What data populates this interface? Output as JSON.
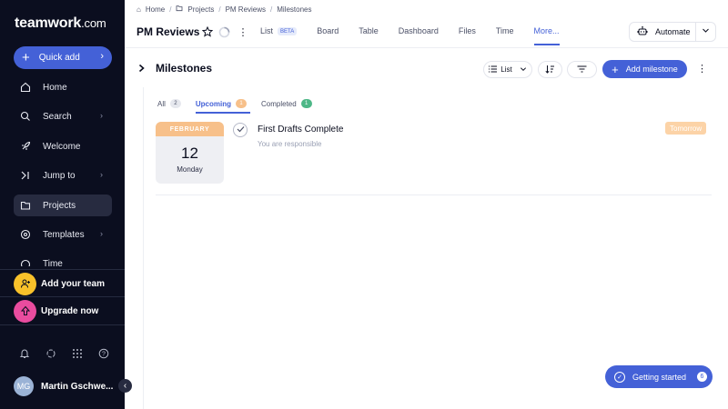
{
  "sidebar": {
    "logo_main": "teamwork",
    "logo_suffix": ".com",
    "quick_add": "Quick add",
    "items": [
      {
        "label": "Home"
      },
      {
        "label": "Search"
      },
      {
        "label": "Welcome"
      },
      {
        "label": "Jump to"
      },
      {
        "label": "Projects"
      },
      {
        "label": "Templates"
      },
      {
        "label": "Time"
      }
    ],
    "add_team": "Add your team",
    "upgrade": "Upgrade now",
    "user_initials": "MG",
    "user_name": "Martin Gschwe..."
  },
  "breadcrumb": [
    "Home",
    "Projects",
    "PM Reviews",
    "Milestones"
  ],
  "project_title": "PM Reviews",
  "tabs": [
    {
      "label": "List",
      "badge": "BETA"
    },
    {
      "label": "Board"
    },
    {
      "label": "Table"
    },
    {
      "label": "Dashboard"
    },
    {
      "label": "Files"
    },
    {
      "label": "Time"
    },
    {
      "label": "More..."
    }
  ],
  "automate_label": "Automate",
  "milestones": {
    "title": "Milestones",
    "view_label": "List",
    "add_label": "Add milestone",
    "subtabs": [
      {
        "label": "All",
        "count": "2",
        "color": "#e6e8ee"
      },
      {
        "label": "Upcoming",
        "count": "1",
        "color": "#f7c08a"
      },
      {
        "label": "Completed",
        "count": "1",
        "color": "#4db787"
      }
    ],
    "item": {
      "month": "FEBRUARY",
      "day": "12",
      "weekday": "Monday",
      "name": "First Drafts Complete",
      "subtitle": "You are responsible",
      "due": "Tomorrow"
    }
  },
  "getting_started": {
    "label": "Getting started",
    "count": "6"
  },
  "colors": {
    "accent": "#4461d7",
    "sidebar_bg": "#0b0e1f",
    "milestone_orange": "#f7c08a"
  }
}
